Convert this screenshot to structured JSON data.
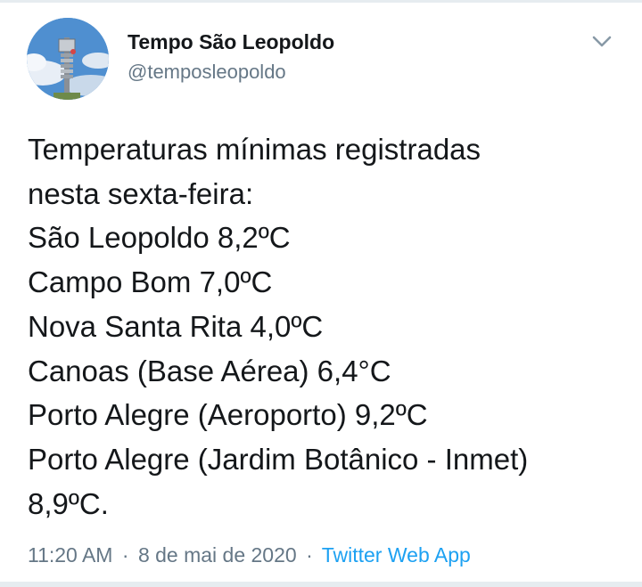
{
  "author": {
    "display_name": "Tempo São Leopoldo",
    "handle": "@temposleopoldo"
  },
  "icons": {
    "avatar": "weather-station-avatar",
    "menu": "chevron-down-icon"
  },
  "tweet": {
    "lines": [
      "Temperaturas mínimas registradas",
      "nesta sexta-feira:",
      "São Leopoldo 8,2ºC",
      "Campo Bom 7,0ºC",
      "Nova Santa Rita 4,0ºC",
      "Canoas (Base Aérea) 6,4°C",
      "Porto Alegre (Aeroporto) 9,2ºC",
      "Porto Alegre (Jardim Botânico - Inmet)",
      "8,9ºC."
    ]
  },
  "meta": {
    "time": "11:20 AM",
    "date": "8 de mai de 2020",
    "separator": "·",
    "source": "Twitter Web App"
  },
  "colors": {
    "text": "#14171a",
    "secondary": "#657786",
    "link": "#1da1f2",
    "border": "#e6ecf0"
  }
}
